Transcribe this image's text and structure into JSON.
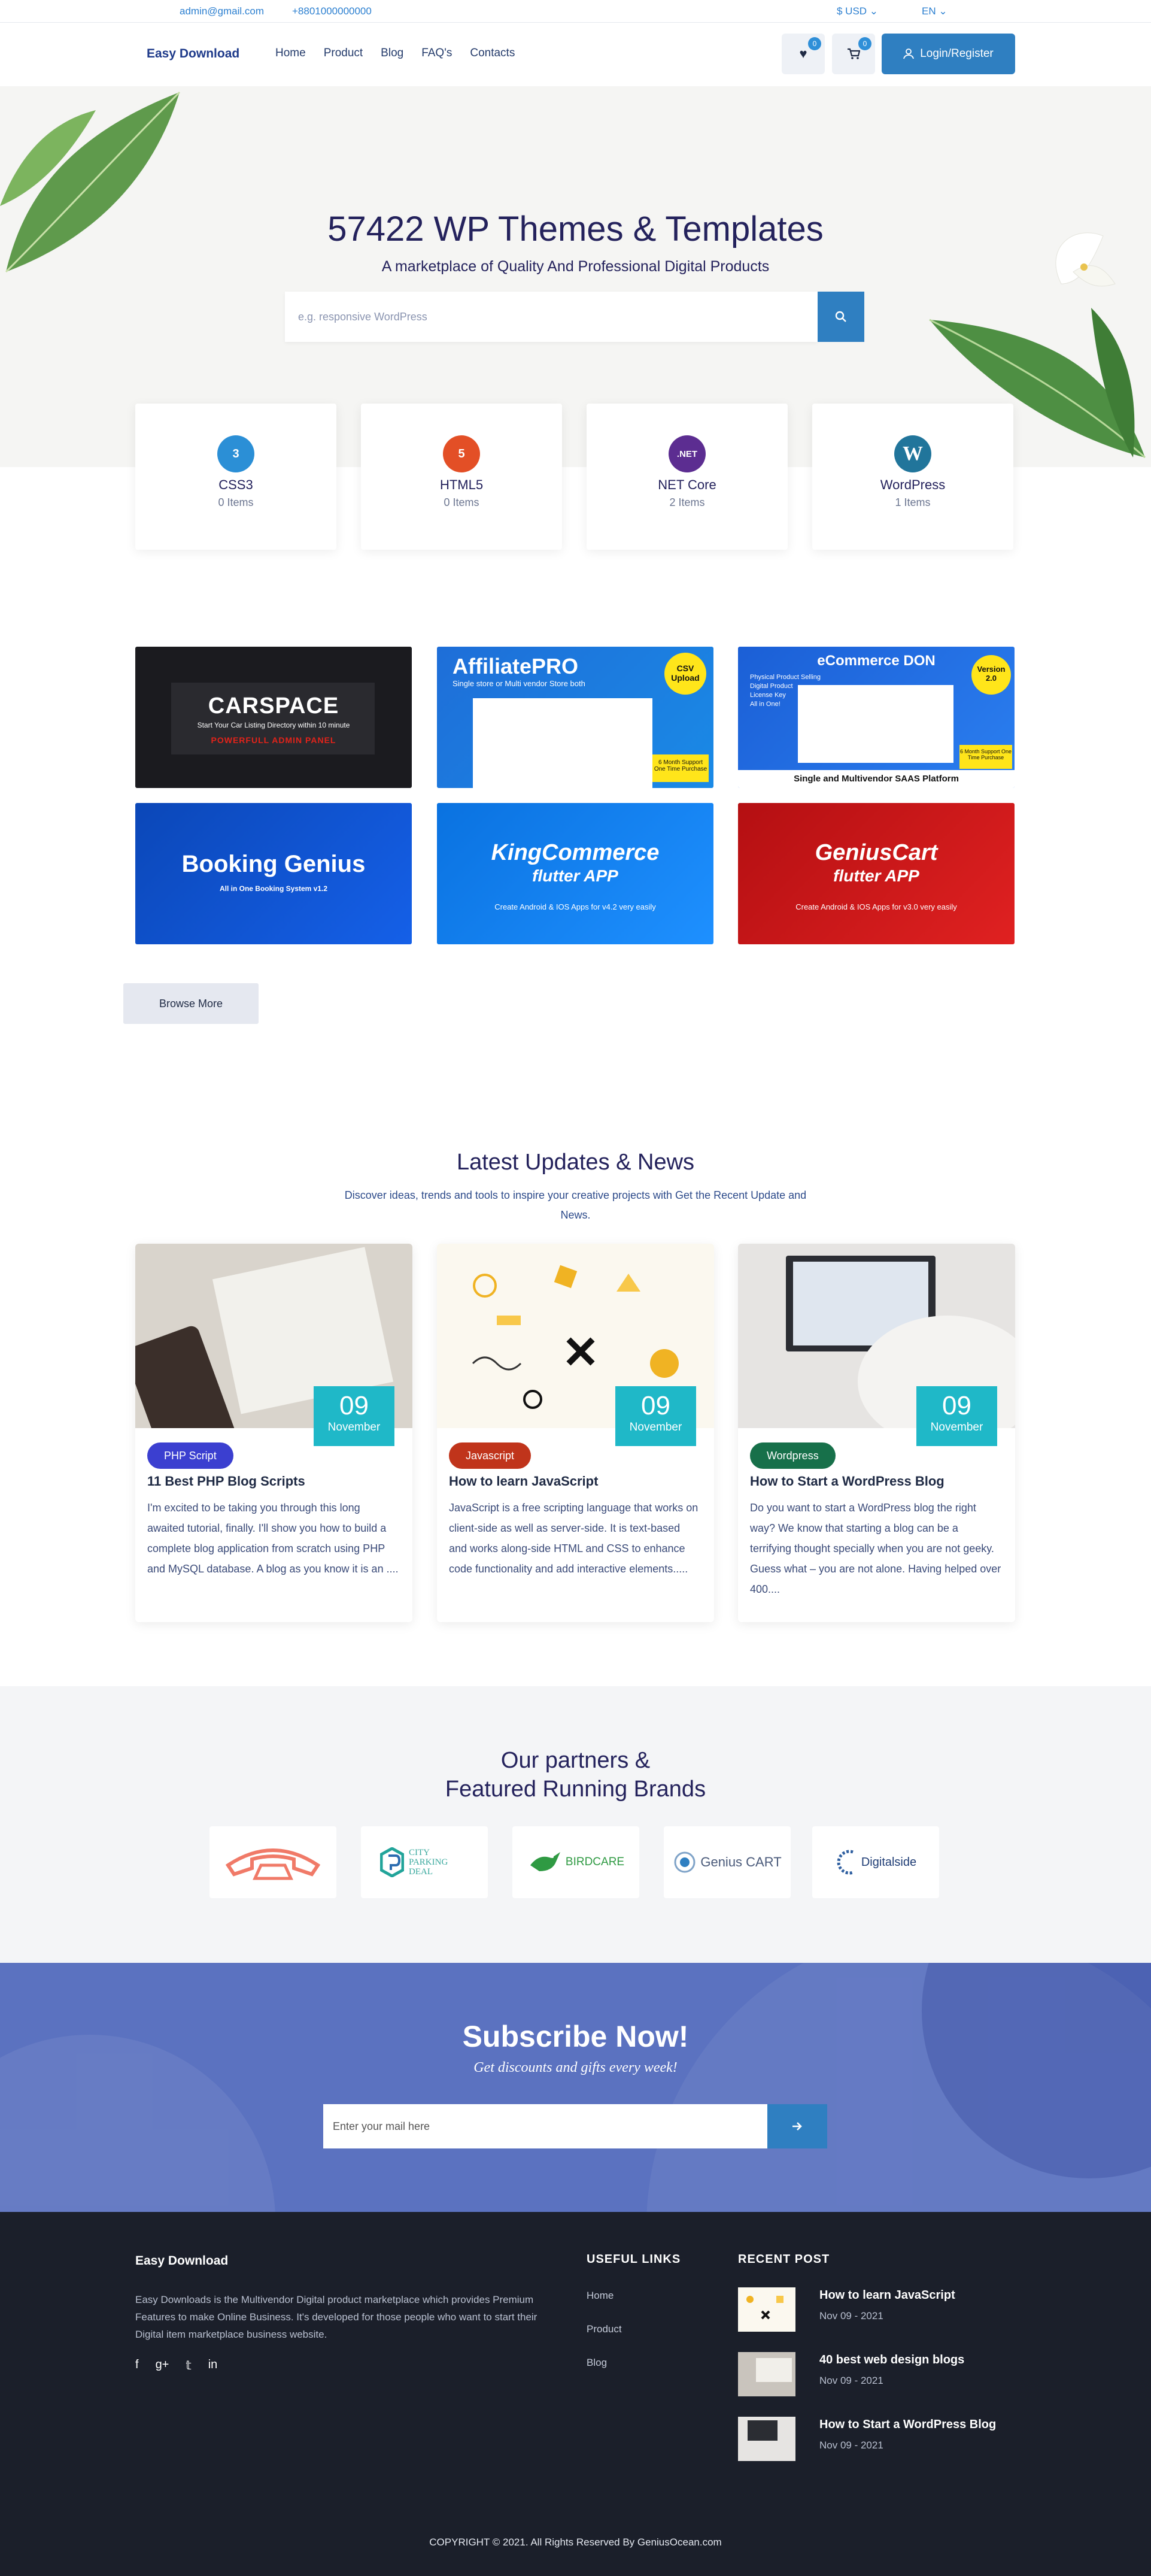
{
  "topbar": {
    "email": "admin@gmail.com",
    "phone": "+8801000000000",
    "currency": "$ USD ⌄",
    "language": "EN ⌄"
  },
  "header": {
    "logo": "Easy Download",
    "nav": [
      "Home",
      "Product",
      "Blog",
      "FAQ's",
      "Contacts"
    ],
    "wishlist_count": "0",
    "cart_count": "0",
    "login_label": "Login/Register"
  },
  "hero": {
    "title": "57422 WP Themes & Templates",
    "subtitle": "A marketplace of Quality And Professional Digital Products",
    "search_placeholder": "e.g. responsive WordPress"
  },
  "categories": [
    {
      "name": "CSS3",
      "count": "0 Items",
      "icon": "css3-icon",
      "color": "#2b8fd6"
    },
    {
      "name": "HTML5",
      "count": "0 Items",
      "icon": "html5-icon",
      "color": "#e34f26"
    },
    {
      "name": "NET Core",
      "count": "2 Items",
      "icon": "dotnet-icon",
      "color": "#5c2d91"
    },
    {
      "name": "WordPress",
      "count": "1 Items",
      "icon": "wordpress-icon",
      "color": "#21759b"
    }
  ],
  "products": [
    {
      "title": "CARSPACE",
      "sub": "Start Your Car Listing Directory within 10 minute",
      "sub2": "POWERFULL ADMIN PANEL"
    },
    {
      "title": "AffiliatePRO",
      "sub": "Single store or Multi vendor Store both",
      "badge": "CSV Upload",
      "note": "6 Month Support One Time Purchase"
    },
    {
      "title": "eCommerce DON",
      "sub": "Single and Multivendor SAAS Platform",
      "badge": "Version 2.0",
      "features": [
        "Physical Product Selling",
        "Digital Product",
        "License Key",
        "All in One!"
      ],
      "note": "6 Month Support One Time Purchase"
    },
    {
      "title": "Booking Genius",
      "sub": "All in One Booking System   v1.2"
    },
    {
      "title": "KingCommerce",
      "title2": "flutter APP",
      "sub": "Create Android & IOS Apps for v4.2 very easily"
    },
    {
      "title": "GeniusCart",
      "title2": "flutter APP",
      "sub": "Create Android & IOS Apps for v3.0 very easily"
    }
  ],
  "browse_label": "Browse More",
  "news": {
    "title": "Latest Updates & News",
    "desc": "Discover ideas, trends and tools to inspire your creative projects with Get the Recent Update and News.",
    "items": [
      {
        "day": "09",
        "month": "November",
        "tag": "PHP Script",
        "tag_color": "#3b3fd0",
        "title": "11 Best PHP Blog Scripts",
        "text": "I'm excited to be taking you through this long awaited tutorial, finally. I'll show you how to build a complete blog application from scratch using PHP and MySQL database. A blog as you know it is an ...."
      },
      {
        "day": "09",
        "month": "November",
        "tag": "Javascript",
        "tag_color": "#c0341b",
        "title": "How to learn JavaScript",
        "text": "JavaScript is a free scripting language that works on client-side as well as server-side. It is text-based and works along-side HTML and CSS to enhance code functionality and add interactive elements....."
      },
      {
        "day": "09",
        "month": "November",
        "tag": "Wordpress",
        "tag_color": "#17704a",
        "title": "How to Start a WordPress Blog",
        "text": "Do you want to start a WordPress blog the right way? We know that starting a blog can be a terrifying thought specially when you are not geeky. Guess what – you are not alone. Having helped over 400...."
      }
    ]
  },
  "partners": {
    "title_line1": "Our partners &",
    "title_line2": "Featured Running Brands",
    "logos": [
      "",
      "CITY PARKING DEAL",
      "BIRDCARE",
      "Genius CART",
      "Digitalside"
    ]
  },
  "subscribe": {
    "title": "Subscribe Now!",
    "desc": "Get discounts and gifts every week!",
    "placeholder": "Enter your mail here"
  },
  "footer": {
    "brand": "Easy Download",
    "text": "Easy Downloads is the Multivendor Digital product marketplace which provides Premium Features to make Online Business. It's developed for those people who want to start their Digital item marketplace business website.",
    "links_title": "USEFUL LINKS",
    "links": [
      "Home",
      "Product",
      "Blog"
    ],
    "recent_title": "RECENT POST",
    "recent": [
      {
        "title": "How to learn JavaScript",
        "date": "Nov 09 - 2021"
      },
      {
        "title": "40 best web design blogs",
        "date": "Nov 09 - 2021"
      },
      {
        "title": "How to Start a WordPress Blog",
        "date": "Nov 09 - 2021"
      }
    ],
    "copyright": "COPYRIGHT © 2021. All Rights Reserved By GeniusOcean.com"
  }
}
